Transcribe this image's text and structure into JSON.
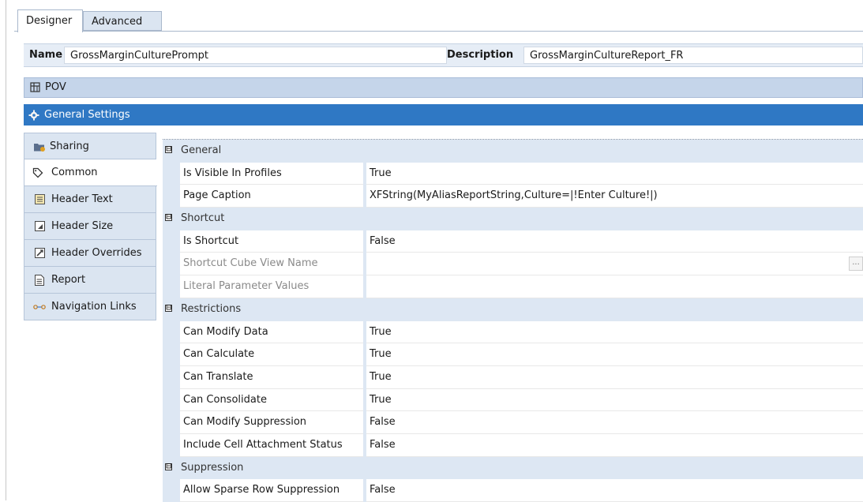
{
  "tabs": [
    {
      "label": "Designer",
      "active": true
    },
    {
      "label": "Advanced",
      "active": false
    }
  ],
  "header": {
    "name_label": "Name",
    "name_value": "GrossMarginCulturePrompt",
    "description_label": "Description",
    "description_value": "GrossMarginCultureReport_FR"
  },
  "sections": {
    "pov": {
      "label": "POV",
      "icon": "pov-grid-icon"
    },
    "general_settings": {
      "label": "General Settings",
      "icon": "gear-icon"
    }
  },
  "nav": {
    "items": [
      {
        "label": "Sharing",
        "icon": "sharing-folder-icon",
        "active": false
      },
      {
        "label": "Common",
        "icon": "tag-icon",
        "active": true
      },
      {
        "label": "Header Text",
        "icon": "header-text-icon",
        "active": false
      },
      {
        "label": "Header Size",
        "icon": "header-size-icon",
        "active": false
      },
      {
        "label": "Header Overrides",
        "icon": "header-overrides-icon",
        "active": false
      },
      {
        "label": "Report",
        "icon": "report-icon",
        "active": false
      },
      {
        "label": "Navigation Links",
        "icon": "navigation-links-icon",
        "active": false
      }
    ]
  },
  "grid": {
    "categories": [
      {
        "label": "General",
        "expander": "⊟",
        "properties": [
          {
            "name": "Is Visible In Profiles",
            "value": "True",
            "disabled": false
          },
          {
            "name": "Page Caption",
            "value": "XFString(MyAliasReportString,Culture=|!Enter Culture!|)",
            "disabled": false
          }
        ]
      },
      {
        "label": "Shortcut",
        "expander": "⊟",
        "properties": [
          {
            "name": "Is Shortcut",
            "value": "False",
            "disabled": false
          },
          {
            "name": "Shortcut Cube View Name",
            "value": "",
            "disabled": true,
            "has_ellipsis": true
          },
          {
            "name": "Literal Parameter Values",
            "value": "",
            "disabled": true
          }
        ]
      },
      {
        "label": "Restrictions",
        "expander": "⊟",
        "properties": [
          {
            "name": "Can Modify Data",
            "value": "True",
            "disabled": false
          },
          {
            "name": "Can Calculate",
            "value": "True",
            "disabled": false
          },
          {
            "name": "Can Translate",
            "value": "True",
            "disabled": false
          },
          {
            "name": "Can Consolidate",
            "value": "True",
            "disabled": false
          },
          {
            "name": "Can Modify Suppression",
            "value": "False",
            "disabled": false
          },
          {
            "name": "Include Cell Attachment Status",
            "value": "False",
            "disabled": false
          }
        ]
      },
      {
        "label": "Suppression",
        "expander": "⊟",
        "properties": [
          {
            "name": "Allow Sparse Row Suppression",
            "value": "False",
            "disabled": false
          }
        ]
      }
    ],
    "ellipsis_label": "..."
  },
  "colors": {
    "accent": "#2f78c4",
    "panel": "#dbe5f1",
    "category_row": "#dde7f3"
  }
}
